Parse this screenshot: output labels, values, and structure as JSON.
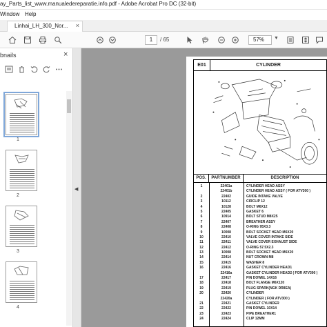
{
  "window": {
    "title": "ay_Parts_list_www.manualedereparatie.info.pdf - Adobe Acrobat Pro DC (32-bit)"
  },
  "menu": {
    "items": [
      "Window",
      "Help"
    ]
  },
  "tabs": {
    "active_label": "Linhai_LH_300_Nor...",
    "close_glyph": "×"
  },
  "toolbar": {
    "page_current": "1",
    "page_total": "/ 65",
    "zoom": "57%"
  },
  "nav": {
    "title": "bnails",
    "close_glyph": "×",
    "thumbnails": [
      "1",
      "2",
      "3",
      "4"
    ]
  },
  "document": {
    "section_code": "E01",
    "section_title": "CYLINDER",
    "columns": {
      "pos": "POS.",
      "partnumber": "PARTNUMBER",
      "description": "DESCRIPTION"
    },
    "parts": [
      {
        "pos": "1",
        "pn": "22401a",
        "desc": "CYLINDER HEAD ASSY"
      },
      {
        "pos": "",
        "pn": "22401b",
        "desc": "CYLINDER HEAD ASSY   ( FOR ATV300 )"
      },
      {
        "pos": "2",
        "pn": "22402",
        "desc": "GUIDE INTAKE VALVE"
      },
      {
        "pos": "3",
        "pn": "10112",
        "desc": "CIRCLIP 12"
      },
      {
        "pos": "4",
        "pn": "10128",
        "desc": "BOLT M6X12"
      },
      {
        "pos": "5",
        "pn": "22405",
        "desc": "GASKET 6"
      },
      {
        "pos": "6",
        "pn": "10914",
        "desc": "BOLT STUD M8X25"
      },
      {
        "pos": "7",
        "pn": "22407",
        "desc": "BREATHER ASSY"
      },
      {
        "pos": "8",
        "pn": "22408",
        "desc": "O-RING 95X3.3"
      },
      {
        "pos": "9",
        "pn": "10008",
        "desc": "BOLT SOCKET HEAD M6X20"
      },
      {
        "pos": "10",
        "pn": "22410",
        "desc": "VALVE COVER INTAKE SIDE"
      },
      {
        "pos": "11",
        "pn": "22411",
        "desc": "VALVE COVER EXHAUST SIDE"
      },
      {
        "pos": "12",
        "pn": "22412",
        "desc": "O-RING 57.5X2.3"
      },
      {
        "pos": "13",
        "pn": "10008",
        "desc": "BOLT SOCKET HEAD M6X20"
      },
      {
        "pos": "14",
        "pn": "22414",
        "desc": "NUT CROWN M8"
      },
      {
        "pos": "15",
        "pn": "22415",
        "desc": "WASHER 8"
      },
      {
        "pos": "16",
        "pn": "22416",
        "desc": "GASKET CYLINDER HEAD1"
      },
      {
        "pos": "",
        "pn": "22416a",
        "desc": "GASKET CYLINDER HEAD2   ( FOR ATV300 )"
      },
      {
        "pos": "17",
        "pn": "22417",
        "desc": "PIN DOWEL 14X16"
      },
      {
        "pos": "18",
        "pn": "22418",
        "desc": "BOLT FLANGE M6X120"
      },
      {
        "pos": "19",
        "pn": "22419",
        "desc": "PLUG SPARK(NGK DR8EA)"
      },
      {
        "pos": "20",
        "pn": "22420",
        "desc": "CYLINDER"
      },
      {
        "pos": "",
        "pn": "22420a",
        "desc": "CYLINDER   ( FOR ATV300 )"
      },
      {
        "pos": "21",
        "pn": "22421",
        "desc": "GASKET CYLINDER"
      },
      {
        "pos": "22",
        "pn": "22422",
        "desc": "PIN DOWEL 10X14"
      },
      {
        "pos": "23",
        "pn": "22423",
        "desc": "PIPE BREATHER1"
      },
      {
        "pos": "24",
        "pn": "22424",
        "desc": "CLIP 12MM"
      }
    ]
  }
}
